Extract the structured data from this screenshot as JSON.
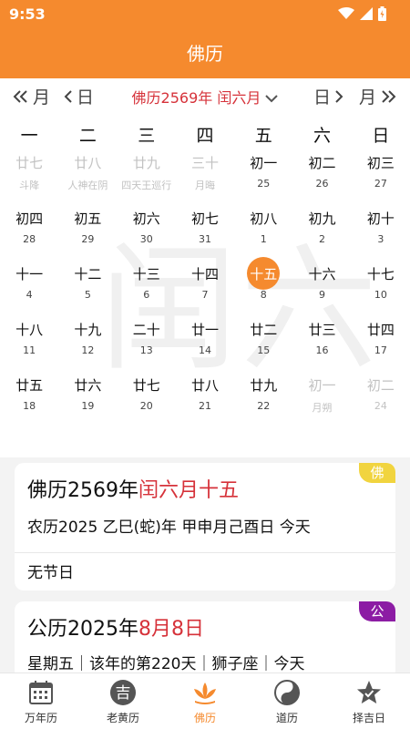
{
  "status": {
    "time": "9:53"
  },
  "header": {
    "title": "佛历"
  },
  "nav": {
    "prev_month": "月",
    "prev_day": "日",
    "month_title": "佛历2569年 闰六月",
    "next_day": "日",
    "next_month": "月"
  },
  "calendar": {
    "watermark": "闰六",
    "weekdays": [
      "一",
      "二",
      "三",
      "四",
      "五",
      "六",
      "日"
    ],
    "rows": [
      [
        {
          "lunar": "廿七",
          "sub": "斗降",
          "dim": true
        },
        {
          "lunar": "廿八",
          "sub": "人神在阴",
          "dim": true
        },
        {
          "lunar": "廿九",
          "sub": "四天王巡行",
          "dim": true
        },
        {
          "lunar": "三十",
          "sub": "月晦",
          "dim": true
        },
        {
          "lunar": "初一",
          "sub": "25"
        },
        {
          "lunar": "初二",
          "sub": "26"
        },
        {
          "lunar": "初三",
          "sub": "27"
        }
      ],
      [
        {
          "lunar": "初四",
          "sub": "28"
        },
        {
          "lunar": "初五",
          "sub": "29"
        },
        {
          "lunar": "初六",
          "sub": "30"
        },
        {
          "lunar": "初七",
          "sub": "31"
        },
        {
          "lunar": "初八",
          "sub": "1"
        },
        {
          "lunar": "初九",
          "sub": "2"
        },
        {
          "lunar": "初十",
          "sub": "3"
        }
      ],
      [
        {
          "lunar": "十一",
          "sub": "4"
        },
        {
          "lunar": "十二",
          "sub": "5"
        },
        {
          "lunar": "十三",
          "sub": "6"
        },
        {
          "lunar": "十四",
          "sub": "7"
        },
        {
          "lunar": "十五",
          "sub": "8",
          "today": true
        },
        {
          "lunar": "十六",
          "sub": "9"
        },
        {
          "lunar": "十七",
          "sub": "10"
        }
      ],
      [
        {
          "lunar": "十八",
          "sub": "11"
        },
        {
          "lunar": "十九",
          "sub": "12"
        },
        {
          "lunar": "二十",
          "sub": "13"
        },
        {
          "lunar": "廿一",
          "sub": "14"
        },
        {
          "lunar": "廿二",
          "sub": "15"
        },
        {
          "lunar": "廿三",
          "sub": "16"
        },
        {
          "lunar": "廿四",
          "sub": "17"
        }
      ],
      [
        {
          "lunar": "廿五",
          "sub": "18"
        },
        {
          "lunar": "廿六",
          "sub": "19"
        },
        {
          "lunar": "廿七",
          "sub": "20"
        },
        {
          "lunar": "廿八",
          "sub": "21"
        },
        {
          "lunar": "廿九",
          "sub": "22"
        },
        {
          "lunar": "初一",
          "sub": "月朔",
          "dim": true
        },
        {
          "lunar": "初二",
          "sub": "24",
          "dim": true
        }
      ]
    ]
  },
  "fo_card": {
    "badge": "佛",
    "title_prefix": "佛历2569年",
    "title_highlight": "闰六月十五",
    "lunar_line": "农历2025 乙巳(蛇)年 甲申月己酉日 今天",
    "festival": "无节日"
  },
  "gong_card": {
    "badge": "公",
    "title_prefix": "公历2025年",
    "title_highlight": "8月8日",
    "info_line": "星期五｜该年的第220天｜狮子座｜今天"
  },
  "tabs": [
    {
      "label": "万年历",
      "icon": "calendar-icon"
    },
    {
      "label": "老黄历",
      "icon": "ji-icon",
      "glyph": "吉"
    },
    {
      "label": "佛历",
      "icon": "lotus-icon",
      "active": true
    },
    {
      "label": "道历",
      "icon": "taiji-icon"
    },
    {
      "label": "择吉日",
      "icon": "star-icon"
    }
  ],
  "colors": {
    "brand": "#f58a2e",
    "highlight_red": "#d6323a",
    "fo_badge": "#f1d43f",
    "gong_badge": "#8c1ca4"
  }
}
